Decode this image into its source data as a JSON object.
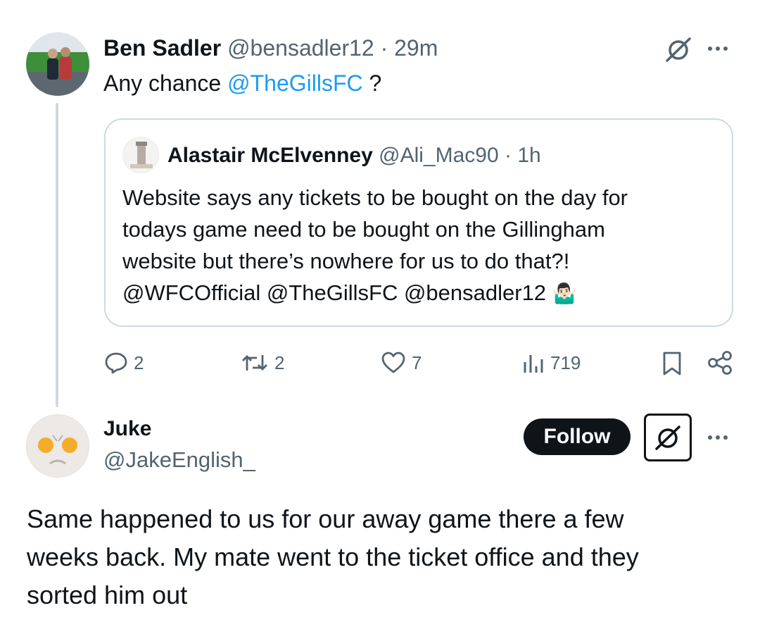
{
  "tweet": {
    "author_name": "Ben Sadler",
    "handle": "@bensadler12",
    "separator": "·",
    "time": "29m",
    "text_prefix": "Any chance ",
    "mention": "@TheGillsFC",
    "text_suffix": " ?",
    "icons": {
      "grok": "grok-icon",
      "more": "more-icon"
    }
  },
  "quote": {
    "author_name": "Alastair McElvenney",
    "handle": "@Ali_Mac90",
    "separator": "·",
    "time": "1h",
    "lines": [
      "Website says any tickets to be bought on the day for",
      "todays game need to be bought on the Gillingham",
      "website but there’s nowhere for us to do that?!",
      "@WFCOfficial @TheGillsFC @bensadler12"
    ],
    "emoji": "🤷🏻‍♂️"
  },
  "actions": {
    "replies": "2",
    "retweets": "2",
    "likes": "7",
    "views": "719",
    "icons": [
      "reply-icon",
      "retweet-icon",
      "like-icon",
      "views-icon",
      "bookmark-icon",
      "share-icon"
    ]
  },
  "reply": {
    "author_name": "Juke",
    "handle": "@JakeEnglish_",
    "follow_label": "Follow",
    "lines": [
      "Same happened to us for our away game there a few",
      "weeks back. My mate went to the ticket office and they",
      "sorted him out"
    ]
  },
  "colors": {
    "text": "#0f1419",
    "muted": "#536471",
    "link": "#1d9bf0",
    "border": "#cfd9de",
    "button_bg": "#0f1419"
  }
}
